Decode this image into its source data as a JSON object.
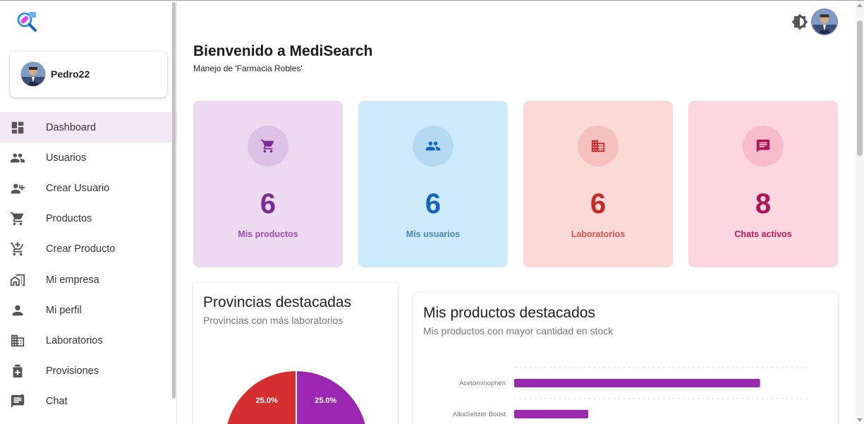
{
  "sidebar": {
    "user": {
      "name": "Pedro22"
    },
    "items": [
      {
        "label": "Dashboard",
        "icon": "dashboard-icon",
        "active": true
      },
      {
        "label": "Usuarios",
        "icon": "people-icon"
      },
      {
        "label": "Crear Usuario",
        "icon": "person-add-icon"
      },
      {
        "label": "Productos",
        "icon": "cart-icon"
      },
      {
        "label": "Crear Producto",
        "icon": "cart-add-icon"
      },
      {
        "label": "Mi empresa",
        "icon": "company-icon"
      },
      {
        "label": "Mi perfil",
        "icon": "person-icon"
      },
      {
        "label": "Laboratorios",
        "icon": "building-icon"
      },
      {
        "label": "Provisiones",
        "icon": "medical-box-icon"
      },
      {
        "label": "Chat",
        "icon": "chat-icon"
      }
    ]
  },
  "header": {
    "title": "Bienvenido a MediSearch",
    "subtitle": "Manejo de 'Farmacia Robles'"
  },
  "stats": [
    {
      "value": "6",
      "label": "Mis productos",
      "icon": "cart-icon",
      "bg": "#ecdaf1",
      "circle": "#dcc0e6",
      "color": "#7b2c93",
      "labelColor": "#9c4fb3"
    },
    {
      "value": "6",
      "label": "Mis usuarios",
      "icon": "people-icon",
      "bg": "#cdeafb",
      "circle": "#b4d9f1",
      "color": "#1565c0",
      "labelColor": "#4f86b6"
    },
    {
      "value": "6",
      "label": "Laboratorios",
      "icon": "building-icon",
      "bg": "#fbd9d7",
      "circle": "#f5c1bf",
      "color": "#c62828",
      "labelColor": "#d9534f"
    },
    {
      "value": "8",
      "label": "Chats activos",
      "icon": "chat-icon",
      "bg": "#fcd6e0",
      "circle": "#f6bccc",
      "color": "#ad1457",
      "labelColor": "#c2185b"
    }
  ],
  "provincias": {
    "title": "Provincias destacadas",
    "subtitle": "Provincias con más laboratorios"
  },
  "productos": {
    "title": "Mis productos destacados",
    "subtitle": "Mis productos con mayor cantidad en stock"
  },
  "chart_data": [
    {
      "type": "pie",
      "title": "Provincias destacadas",
      "subtitle": "Provincias con más laboratorios",
      "slices": [
        {
          "value": 25.0,
          "label": "25.0%",
          "color": "#d32f2f"
        },
        {
          "value": 25.0,
          "label": "25.0%",
          "color": "#9c27b0"
        }
      ]
    },
    {
      "type": "bar",
      "orientation": "horizontal",
      "title": "Mis productos destacados",
      "subtitle": "Mis productos con mayor cantidad en stock",
      "categories": [
        "Acetominophen",
        "AlkaSeltzer Boost"
      ],
      "values": [
        83,
        25
      ],
      "xlim": [
        0,
        100
      ],
      "color": "#9c27b0",
      "grid": true
    }
  ]
}
